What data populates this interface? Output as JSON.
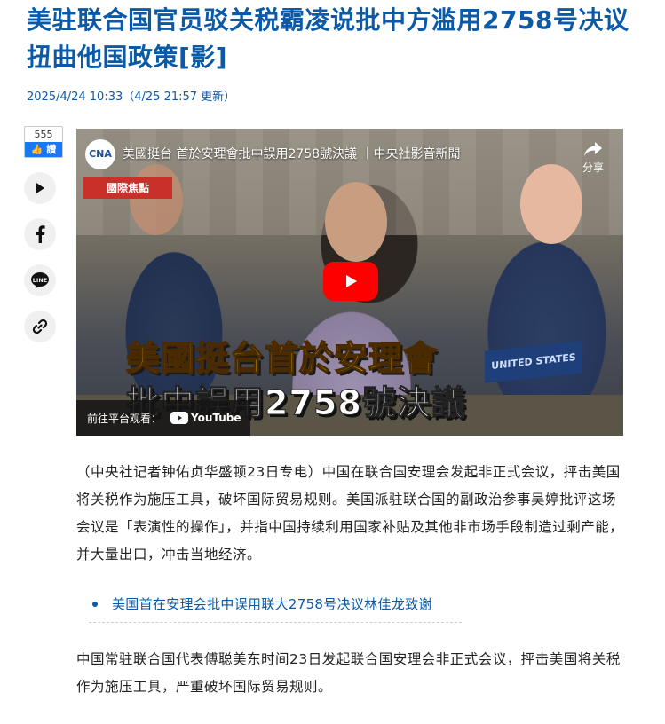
{
  "article": {
    "headline": "美驻联合国官员驳关税霸凌说批中方滥用2758号决议扭曲他国政策[影]",
    "dateline": "2025/4/24 10:33（4/25 21:57 更新）"
  },
  "social": {
    "like_count": "555",
    "like_label": "讚"
  },
  "video": {
    "logo_text": "CNA",
    "title": "美國挺台 首於安理會批中誤用2758號決議 ｜中央社影音新聞",
    "share_label": "分享",
    "badge": "國際焦點",
    "caption_line1": "美國挺台首於安理會",
    "caption_line2": "批中誤用2758號決議",
    "nameplate": "UNITED STATES",
    "watch_on": "前往平台观看：",
    "platform": "YouTube"
  },
  "body": {
    "paragraph1": "（中央社记者钟佑贞华盛顿23日专电）中国在联合国安理会发起非正式会议，抨击美国将关税作为施压工具，破坏国际贸易规则。美国派驻联合国的副政治参事吴婷批评这场会议是「表演性的操作」，并指中国持续利用国家补贴及其他非市场手段制造过剩产能，并大量出口，冲击当地经济。",
    "related_link": "美国首在安理会批中误用联大2758号决议林佳龙致谢",
    "paragraph2": "中国常驻联合国代表傅聪美东时间23日发起联合国安理会非正式会议，抨击美国将关税作为施压工具，严重破坏国际贸易规则。"
  },
  "colors": {
    "accent": "#0a5aa8",
    "facebook": "#1877f2",
    "youtube_red": "#ff0000"
  }
}
